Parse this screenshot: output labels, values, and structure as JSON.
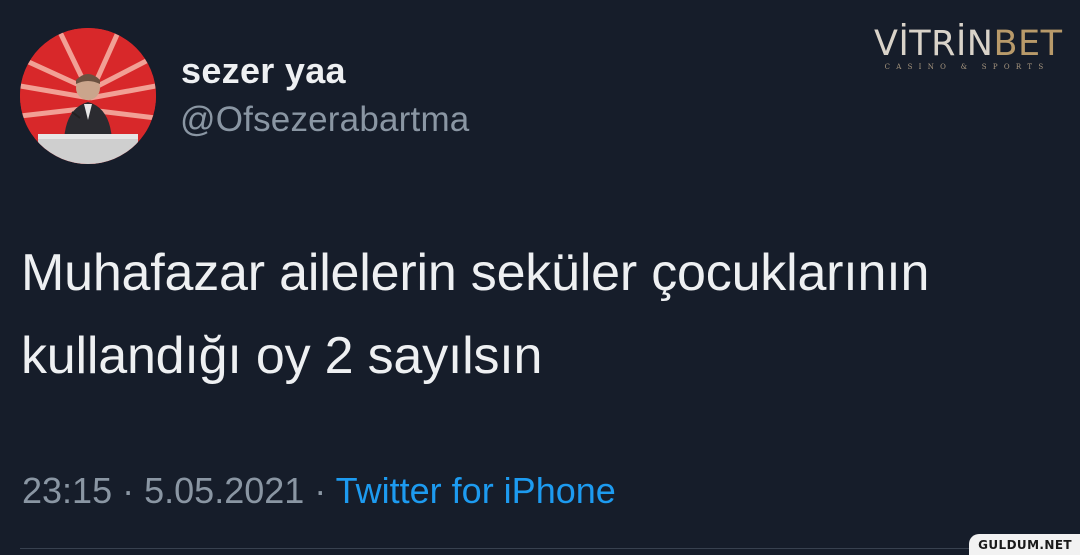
{
  "author": {
    "display_name": "sezer yaa",
    "handle": "@Ofsezerabartma",
    "avatar_icon": "profile-photo-speaker-at-podium"
  },
  "brand": {
    "name": "VİTRİNBET",
    "tagline": "CASINO & SPORTS",
    "accent_color": "#b89a6a"
  },
  "tweet": {
    "lines": [
      "Muhafazar ailelerin seküler çocuklarının",
      "kullandığı oy 2 sayılsın"
    ]
  },
  "meta": {
    "time": "23:15",
    "separator": "·",
    "date": "5.05.2021",
    "source": "Twitter for iPhone",
    "source_color": "#1d9bf0"
  },
  "watermark": "GULDUM.NET",
  "colors": {
    "background": "#161d2a",
    "text": "#eef0f2",
    "muted": "#8a96a3"
  }
}
